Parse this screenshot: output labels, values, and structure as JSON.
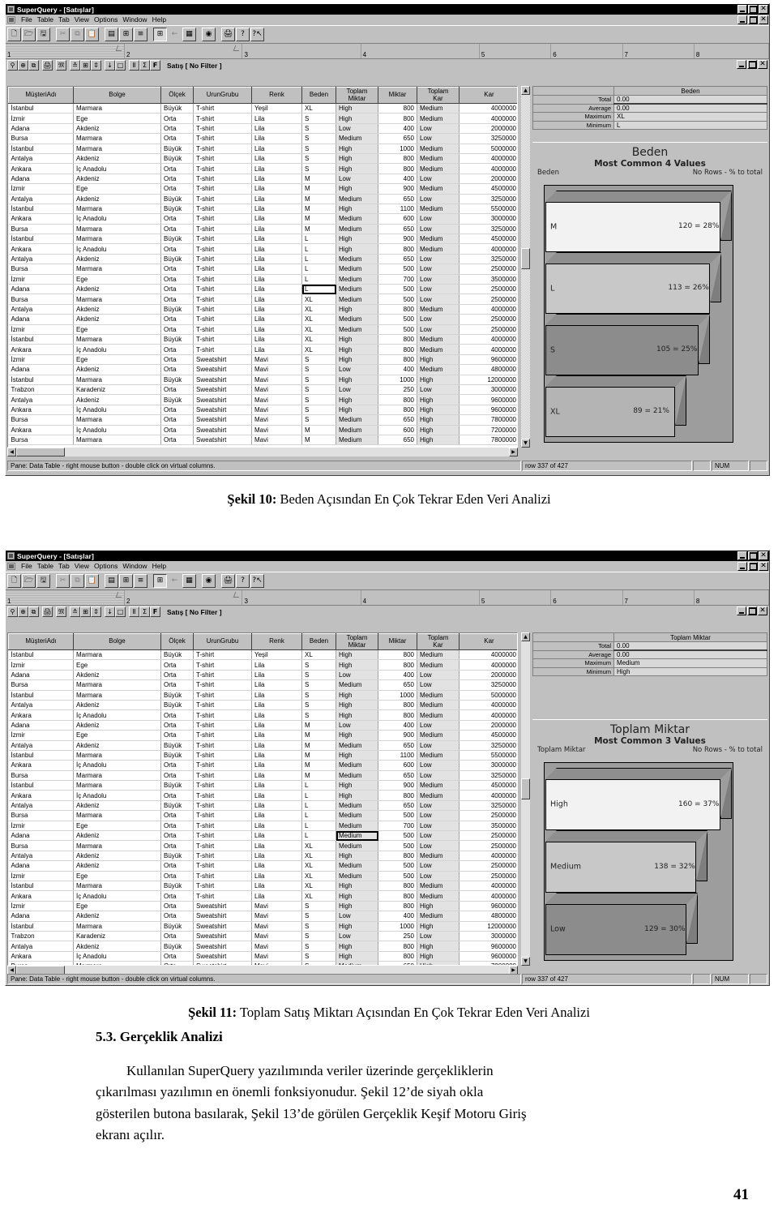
{
  "app": {
    "title": "SuperQuery - [Satışlar]",
    "menus": [
      "File",
      "Table",
      "Tab",
      "View",
      "Options",
      "Window",
      "Help"
    ],
    "ruler_tabs": [
      "1",
      "2",
      "3",
      "4",
      "5",
      "6",
      "7",
      "8"
    ],
    "filter_label": "Satış [ No Filter ]",
    "window_buttons": [
      "minimize",
      "restore",
      "close"
    ],
    "toolbar_icons": [
      "new-document-icon",
      "open-folder-icon",
      "save-disk-icon",
      "cut-scissors-icon",
      "copy-icon",
      "paste-icon",
      "align-icon",
      "columns-icon",
      "rows-icon",
      "grid-table-icon",
      "back-arrow-icon",
      "detail-grid-icon",
      "query-engine-icon",
      "print-icon",
      "help-question-icon",
      "help-pointer-icon"
    ],
    "pane_icons": [
      "pane-anchor-icon",
      "zoom-icon",
      "copy-pane-icon",
      "print-pane-icon",
      "binoculars-icon",
      "collapse-icon",
      "grid-icon",
      "expand-icon",
      "sort-az-icon",
      "select-box-icon",
      "stats-icon",
      "sum-sigma-icon",
      "filter-f-icon"
    ],
    "status": {
      "hint": "Pane: Data Table - right mouse button - double click on virtual columns.",
      "row_counter": "row 337 of 427",
      "num_lock": "NUM"
    }
  },
  "grid": {
    "columns": [
      "MüşteriAdı",
      "Bolge",
      "Ölçek",
      "UrunGrubu",
      "Renk",
      "Beden",
      "Toplam Miktar",
      "Miktar",
      "Toplam Kar",
      "Kar"
    ],
    "rows": [
      [
        "İstanbul",
        "Marmara",
        "Büyük",
        "T-shirt",
        "Yeşil",
        "XL",
        "High",
        "800",
        "Medium",
        "4000000"
      ],
      [
        "İzmir",
        "Ege",
        "Orta",
        "T-shirt",
        "Lila",
        "S",
        "High",
        "800",
        "Medium",
        "4000000"
      ],
      [
        "Adana",
        "Akdeniz",
        "Orta",
        "T-shirt",
        "Lila",
        "S",
        "Low",
        "400",
        "Low",
        "2000000"
      ],
      [
        "Bursa",
        "Marmara",
        "Orta",
        "T-shirt",
        "Lila",
        "S",
        "Medium",
        "650",
        "Low",
        "3250000"
      ],
      [
        "İstanbul",
        "Marmara",
        "Büyük",
        "T-shirt",
        "Lila",
        "S",
        "High",
        "1000",
        "Medium",
        "5000000"
      ],
      [
        "Antalya",
        "Akdeniz",
        "Büyük",
        "T-shirt",
        "Lila",
        "S",
        "High",
        "800",
        "Medium",
        "4000000"
      ],
      [
        "Ankara",
        "İç Anadolu",
        "Orta",
        "T-shirt",
        "Lila",
        "S",
        "High",
        "800",
        "Medium",
        "4000000"
      ],
      [
        "Adana",
        "Akdeniz",
        "Orta",
        "T-shirt",
        "Lila",
        "M",
        "Low",
        "400",
        "Low",
        "2000000"
      ],
      [
        "İzmir",
        "Ege",
        "Orta",
        "T-shirt",
        "Lila",
        "M",
        "High",
        "900",
        "Medium",
        "4500000"
      ],
      [
        "Antalya",
        "Akdeniz",
        "Büyük",
        "T-shirt",
        "Lila",
        "M",
        "Medium",
        "650",
        "Low",
        "3250000"
      ],
      [
        "İstanbul",
        "Marmara",
        "Büyük",
        "T-shirt",
        "Lila",
        "M",
        "High",
        "1100",
        "Medium",
        "5500000"
      ],
      [
        "Ankara",
        "İç Anadolu",
        "Orta",
        "T-shirt",
        "Lila",
        "M",
        "Medium",
        "600",
        "Low",
        "3000000"
      ],
      [
        "Bursa",
        "Marmara",
        "Orta",
        "T-shirt",
        "Lila",
        "M",
        "Medium",
        "650",
        "Low",
        "3250000"
      ],
      [
        "İstanbul",
        "Marmara",
        "Büyük",
        "T-shirt",
        "Lila",
        "L",
        "High",
        "900",
        "Medium",
        "4500000"
      ],
      [
        "Ankara",
        "İç Anadolu",
        "Orta",
        "T-shirt",
        "Lila",
        "L",
        "High",
        "800",
        "Medium",
        "4000000"
      ],
      [
        "Antalya",
        "Akdeniz",
        "Büyük",
        "T-shirt",
        "Lila",
        "L",
        "Medium",
        "650",
        "Low",
        "3250000"
      ],
      [
        "Bursa",
        "Marmara",
        "Orta",
        "T-shirt",
        "Lila",
        "L",
        "Medium",
        "500",
        "Low",
        "2500000"
      ],
      [
        "İzmir",
        "Ege",
        "Orta",
        "T-shirt",
        "Lila",
        "L",
        "Medium",
        "700",
        "Low",
        "3500000"
      ],
      [
        "Adana",
        "Akdeniz",
        "Orta",
        "T-shirt",
        "Lila",
        "L",
        "Medium",
        "500",
        "Low",
        "2500000"
      ],
      [
        "Bursa",
        "Marmara",
        "Orta",
        "T-shirt",
        "Lila",
        "XL",
        "Medium",
        "500",
        "Low",
        "2500000"
      ],
      [
        "Antalya",
        "Akdeniz",
        "Büyük",
        "T-shirt",
        "Lila",
        "XL",
        "High",
        "800",
        "Medium",
        "4000000"
      ],
      [
        "Adana",
        "Akdeniz",
        "Orta",
        "T-shirt",
        "Lila",
        "XL",
        "Medium",
        "500",
        "Low",
        "2500000"
      ],
      [
        "İzmir",
        "Ege",
        "Orta",
        "T-shirt",
        "Lila",
        "XL",
        "Medium",
        "500",
        "Low",
        "2500000"
      ],
      [
        "İstanbul",
        "Marmara",
        "Büyük",
        "T-shirt",
        "Lila",
        "XL",
        "High",
        "800",
        "Medium",
        "4000000"
      ],
      [
        "Ankara",
        "İç Anadolu",
        "Orta",
        "T-shirt",
        "Lila",
        "XL",
        "High",
        "800",
        "Medium",
        "4000000"
      ],
      [
        "İzmir",
        "Ege",
        "Orta",
        "Sweatshirt",
        "Mavi",
        "S",
        "High",
        "800",
        "High",
        "9600000"
      ],
      [
        "Adana",
        "Akdeniz",
        "Orta",
        "Sweatshirt",
        "Mavi",
        "S",
        "Low",
        "400",
        "Medium",
        "4800000"
      ],
      [
        "İstanbul",
        "Marmara",
        "Büyük",
        "Sweatshirt",
        "Mavi",
        "S",
        "High",
        "1000",
        "High",
        "12000000"
      ],
      [
        "Trabzon",
        "Karadeniz",
        "Orta",
        "Sweatshirt",
        "Mavi",
        "S",
        "Low",
        "250",
        "Low",
        "3000000"
      ],
      [
        "Antalya",
        "Akdeniz",
        "Büyük",
        "Sweatshirt",
        "Mavi",
        "S",
        "High",
        "800",
        "High",
        "9600000"
      ],
      [
        "Ankara",
        "İç Anadolu",
        "Orta",
        "Sweatshirt",
        "Mavi",
        "S",
        "High",
        "800",
        "High",
        "9600000"
      ],
      [
        "Bursa",
        "Marmara",
        "Orta",
        "Sweatshirt",
        "Mavi",
        "S",
        "Medium",
        "650",
        "High",
        "7800000"
      ],
      [
        "Ankara",
        "İç Anadolu",
        "Orta",
        "Sweatshirt",
        "Mavi",
        "M",
        "Medium",
        "600",
        "High",
        "7200000"
      ],
      [
        "Bursa",
        "Marmara",
        "Orta",
        "Sweatshirt",
        "Mavi",
        "M",
        "Medium",
        "650",
        "High",
        "7800000"
      ]
    ]
  },
  "figure10": {
    "stats": {
      "header": "Beden",
      "labels": [
        "Total",
        "Average",
        "Maximum",
        "Minimum"
      ],
      "values": [
        "0.00",
        "0.00",
        "XL",
        "L"
      ]
    },
    "selected_cell": {
      "row": 18,
      "col": 5,
      "value": "L"
    },
    "caption_prefix": "Şekil 10:",
    "caption_text": "Beden Açısından En Çok Tekrar Eden Veri Analizi",
    "chart_data": {
      "type": "bar",
      "title": "Beden",
      "subtitle": "Most Common 4 Values",
      "xlabel": "Beden",
      "ylabel": "No Rows - % to total",
      "categories": [
        "M",
        "L",
        "S",
        "XL"
      ],
      "values": [
        120,
        113,
        105,
        89
      ],
      "percents": [
        "28%",
        "26%",
        "25%",
        "21%"
      ],
      "labels": [
        "120 = 28%",
        "113 = 26%",
        "105 = 25%",
        "89 = 21%"
      ],
      "colors": [
        "#f2f2f2",
        "#c8c8c8",
        "#8c8c8c",
        "#b4b4b4"
      ],
      "grid": false,
      "legend": "none"
    }
  },
  "figure11": {
    "stats": {
      "header": "Toplam Miktar",
      "labels": [
        "Total",
        "Average",
        "Maximum",
        "Minimum"
      ],
      "values": [
        "0.00",
        "0.00",
        "Medium",
        "High"
      ]
    },
    "selected_cell": {
      "row": 18,
      "col": 6,
      "value": "Medium"
    },
    "caption_prefix": "Şekil 11:",
    "caption_text": "Toplam Satış Miktarı Açısından En Çok Tekrar Eden Veri Analizi",
    "chart_data": {
      "type": "bar",
      "title": "Toplam Miktar",
      "subtitle": "Most Common 3 Values",
      "xlabel": "Toplam Miktar",
      "ylabel": "No Rows - % to total",
      "categories": [
        "High",
        "Medium",
        "Low"
      ],
      "values": [
        160,
        138,
        129
      ],
      "percents": [
        "37%",
        "32%",
        "30%"
      ],
      "labels": [
        "160 = 37%",
        "138 = 32%",
        "129 = 30%"
      ],
      "colors": [
        "#f2f2f2",
        "#c8c8c8",
        "#8c8c8c"
      ],
      "grid": false,
      "legend": "none"
    }
  },
  "document": {
    "section_number": "5.3.",
    "section_title": "Gerçeklik Analizi",
    "paragraph_line1": "Kullanılan SuperQuery yazılımında veriler üzerinde gerçekliklerin",
    "paragraph_line2": "çıkarılması yazılımın en önemli fonksiyonudur. Şekil 12’de siyah okla",
    "paragraph_line3": "gösterilen butona basılarak, Şekil 13’de görülen Gerçeklik Keşif Motoru Giriş",
    "paragraph_line4": "ekranı açılır.",
    "page_number": "41"
  }
}
